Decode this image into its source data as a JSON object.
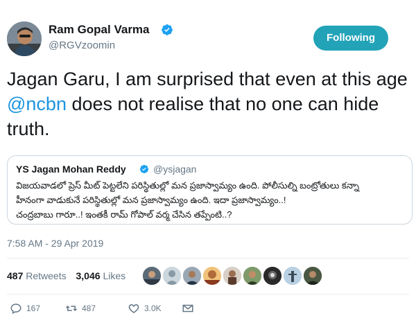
{
  "author": {
    "display_name": "Ram Gopal Varma",
    "handle": "@RGVzoomin"
  },
  "follow_button": {
    "label": "Following"
  },
  "tweet": {
    "text_before": "Jagan Garu, I am surprised that even at this age ",
    "mention": "@ncbn",
    "text_after": " does not realise that no one can hide truth."
  },
  "quoted_tweet": {
    "display_name": "YS Jagan Mohan Reddy",
    "handle": "@ysjagan",
    "lines": [
      "విజయవాడలో ప్రెస్ మీట్ పెట్టలేని పరిస్థితుల్లో మన ప్రజాస్వామ్యం ఉంది. పోలీసుల్ని బంట్రోతులు కన్నా",
      "హీనంగా వాడుకునే పరిస్థితుల్లో మన ప్రజాస్వామ్యం ఉంది. ఇదా ప్రజాస్వామ్యం..!",
      "చంద్రబాబు గారూ..! ఇంతకీ రామ్ గోపాల్ వర్మ చేసిన తప్పేంటి..?"
    ]
  },
  "timestamp": "7:58 AM - 29 Apr 2019",
  "stats": {
    "retweets_count": "487",
    "retweets_label": "Retweets",
    "likes_count": "3,046",
    "likes_label": "Likes"
  },
  "actions": {
    "replies": "167",
    "retweets": "487",
    "likes": "3.0K"
  },
  "colors": {
    "accent": "#1da1f2",
    "follow_button_bg": "#22a3b8",
    "mention": "#1b95e0",
    "muted": "#657786"
  },
  "icons": {
    "verified": "verified-badge-icon",
    "reply": "reply-icon",
    "retweet": "retweet-icon",
    "like": "heart-icon",
    "dm": "envelope-icon"
  }
}
